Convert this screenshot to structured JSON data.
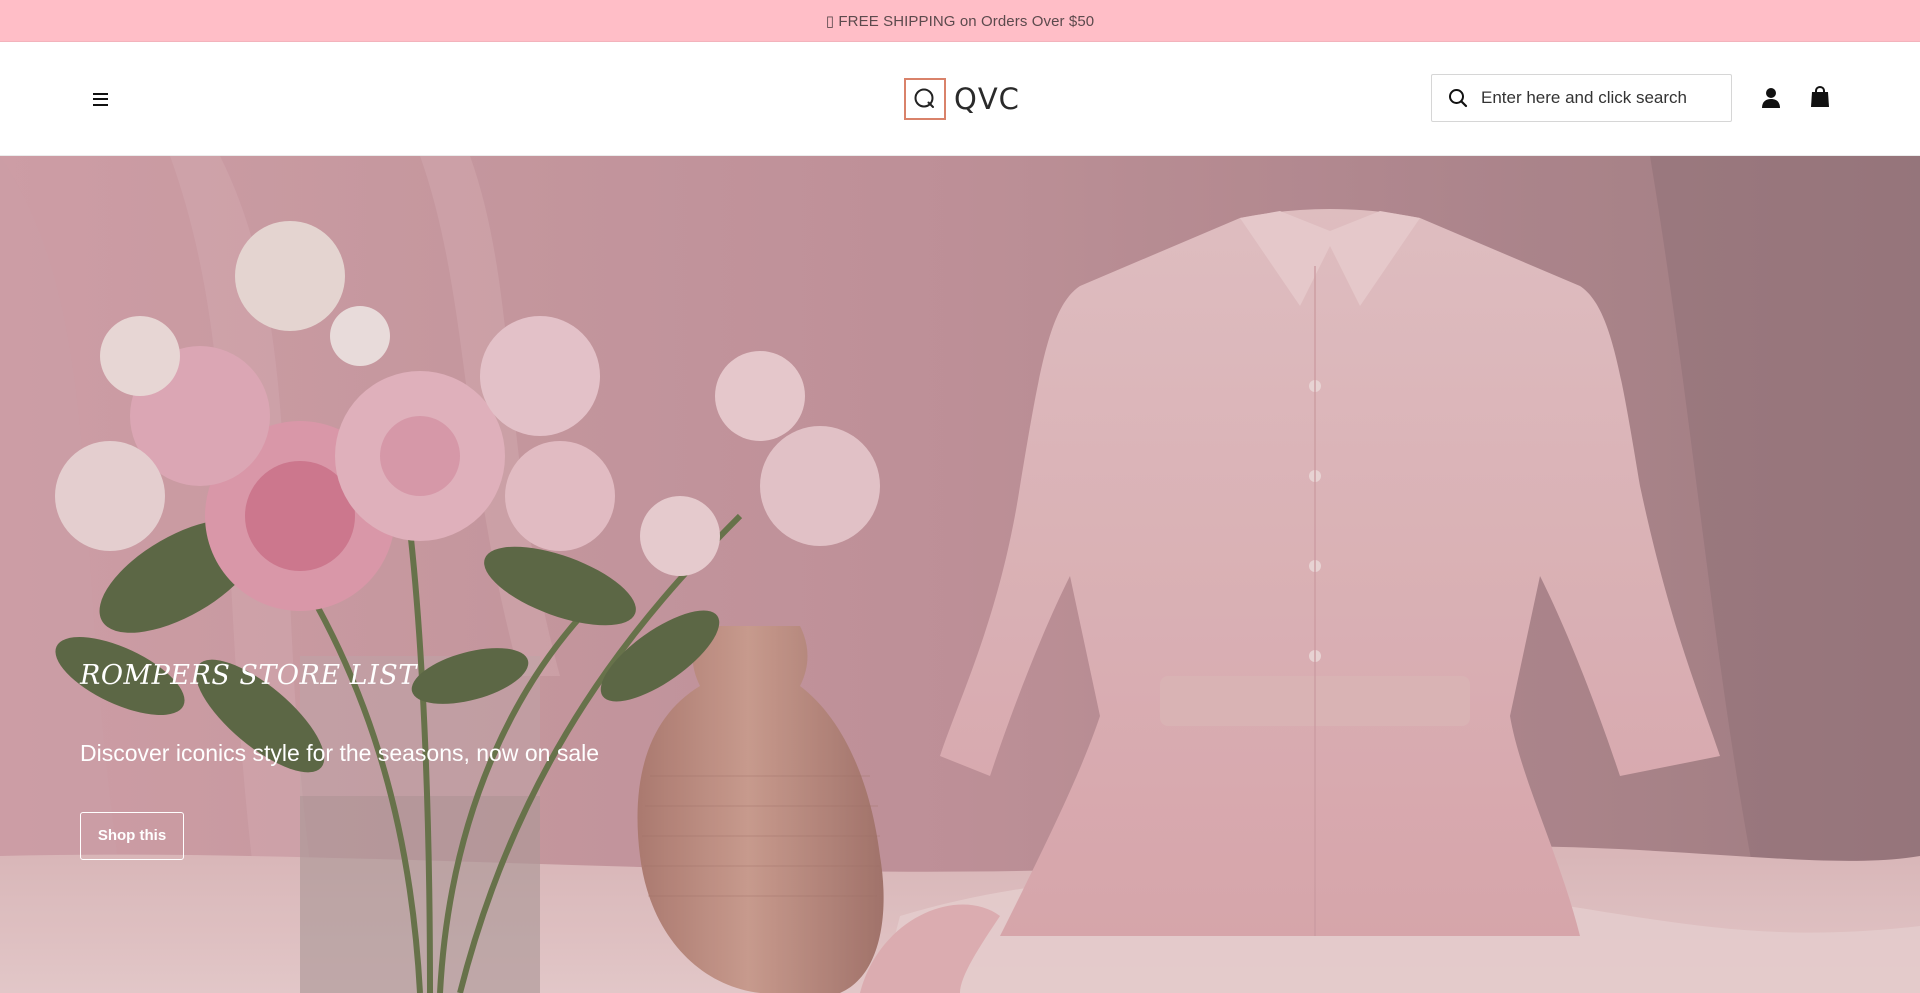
{
  "announcement": {
    "text": "▯ FREE SHIPPING on Orders Over $50",
    "background": "#ffbec7"
  },
  "header": {
    "menu_icon": "hamburger-menu-icon",
    "logo": {
      "mark": "Q",
      "text": "QVC",
      "mark_color": "#d9826a"
    },
    "search": {
      "icon": "search-icon",
      "placeholder": "Enter here and click search"
    },
    "account_icon": "user-icon",
    "cart_icon": "shopping-bag-icon"
  },
  "hero": {
    "title": "ROMPERS STORE LIST",
    "subtitle": "Discover iconics style for the seasons, now on sale",
    "button_label": "Shop this",
    "image_alt": "pink dress on mannequin beside peony bouquet and ceramic vase",
    "palette": {
      "background": "#c09aa0",
      "fabric": "#efc8cc",
      "flower": "#e8a9b6",
      "leaf": "#5f6e48",
      "vase": "#c99a8e"
    }
  }
}
